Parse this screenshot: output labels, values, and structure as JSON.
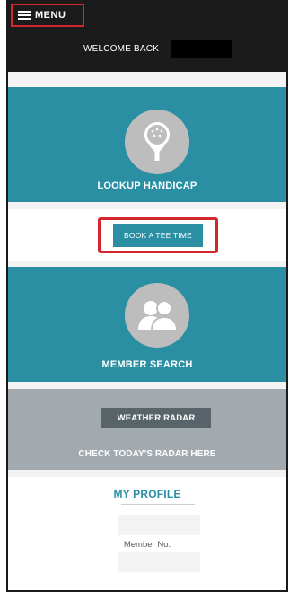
{
  "header": {
    "menu_label": "MENU",
    "welcome_text": "WELCOME BACK"
  },
  "tiles": {
    "handicap_label": "LOOKUP HANDICAP",
    "tee_time_label": "BOOK A TEE TIME",
    "member_search_label": "MEMBER SEARCH",
    "weather_button_label": "WEATHER RADAR",
    "weather_subtitle": "CHECK TODAY'S RADAR HERE"
  },
  "profile": {
    "title": "MY PROFILE",
    "member_no_label": "Member No."
  },
  "icons": {
    "menu": "hamburger-icon",
    "handicap": "golf-ball-on-tee-icon",
    "member_search": "people-icon"
  },
  "colors": {
    "accent_teal": "#2b8fa4",
    "highlight_red": "#d4262d",
    "header_dark": "#1b1b1b",
    "weather_gray": "#a3aaaf",
    "weather_button": "#586469"
  }
}
